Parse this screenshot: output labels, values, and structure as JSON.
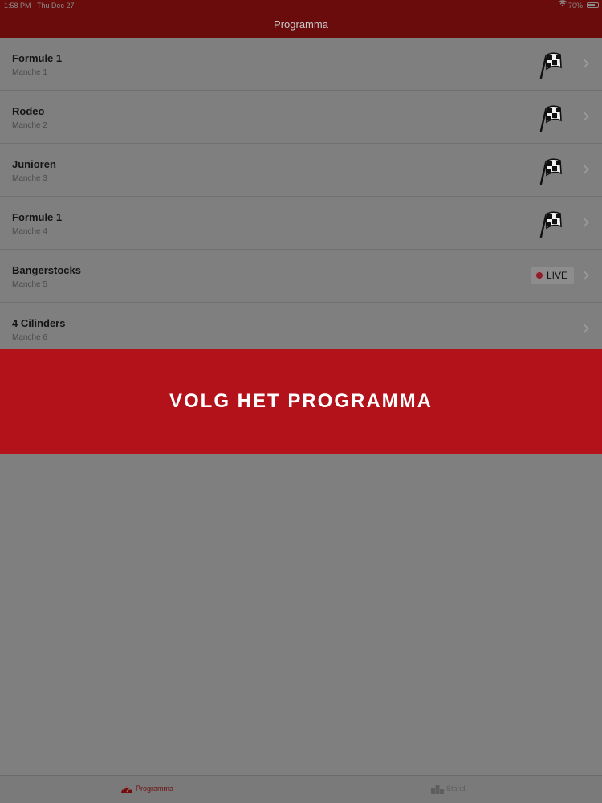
{
  "status": {
    "time": "1:58 PM",
    "date": "Thu Dec 27",
    "battery_percent": "70%"
  },
  "nav": {
    "title": "Programma"
  },
  "programme": [
    {
      "title": "Formule 1",
      "subtitle": "Manche 1",
      "status_icon": "checkered-flag-icon"
    },
    {
      "title": "Rodeo",
      "subtitle": "Manche 2",
      "status_icon": "checkered-flag-icon"
    },
    {
      "title": "Junioren",
      "subtitle": "Manche 3",
      "status_icon": "checkered-flag-icon"
    },
    {
      "title": "Formule 1",
      "subtitle": "Manche 4",
      "status_icon": "checkered-flag-icon"
    },
    {
      "title": "Bangerstocks",
      "subtitle": "Manche 5",
      "live_label": "LIVE"
    },
    {
      "title": "4 Cilinders",
      "subtitle": "Manche 6"
    }
  ],
  "banner": {
    "text": "VOLG HET PROGRAMMA"
  },
  "tabs": [
    {
      "label": "Programma",
      "icon": "speedometer-icon",
      "selected": true
    },
    {
      "label": "Stand",
      "icon": "podium-icon",
      "selected": false
    }
  ],
  "colors": {
    "header": "#6b0c0c",
    "banner": "#b3121b",
    "dim_overlay": "#7f7f7f",
    "active_tab": "#6f0f0f"
  }
}
